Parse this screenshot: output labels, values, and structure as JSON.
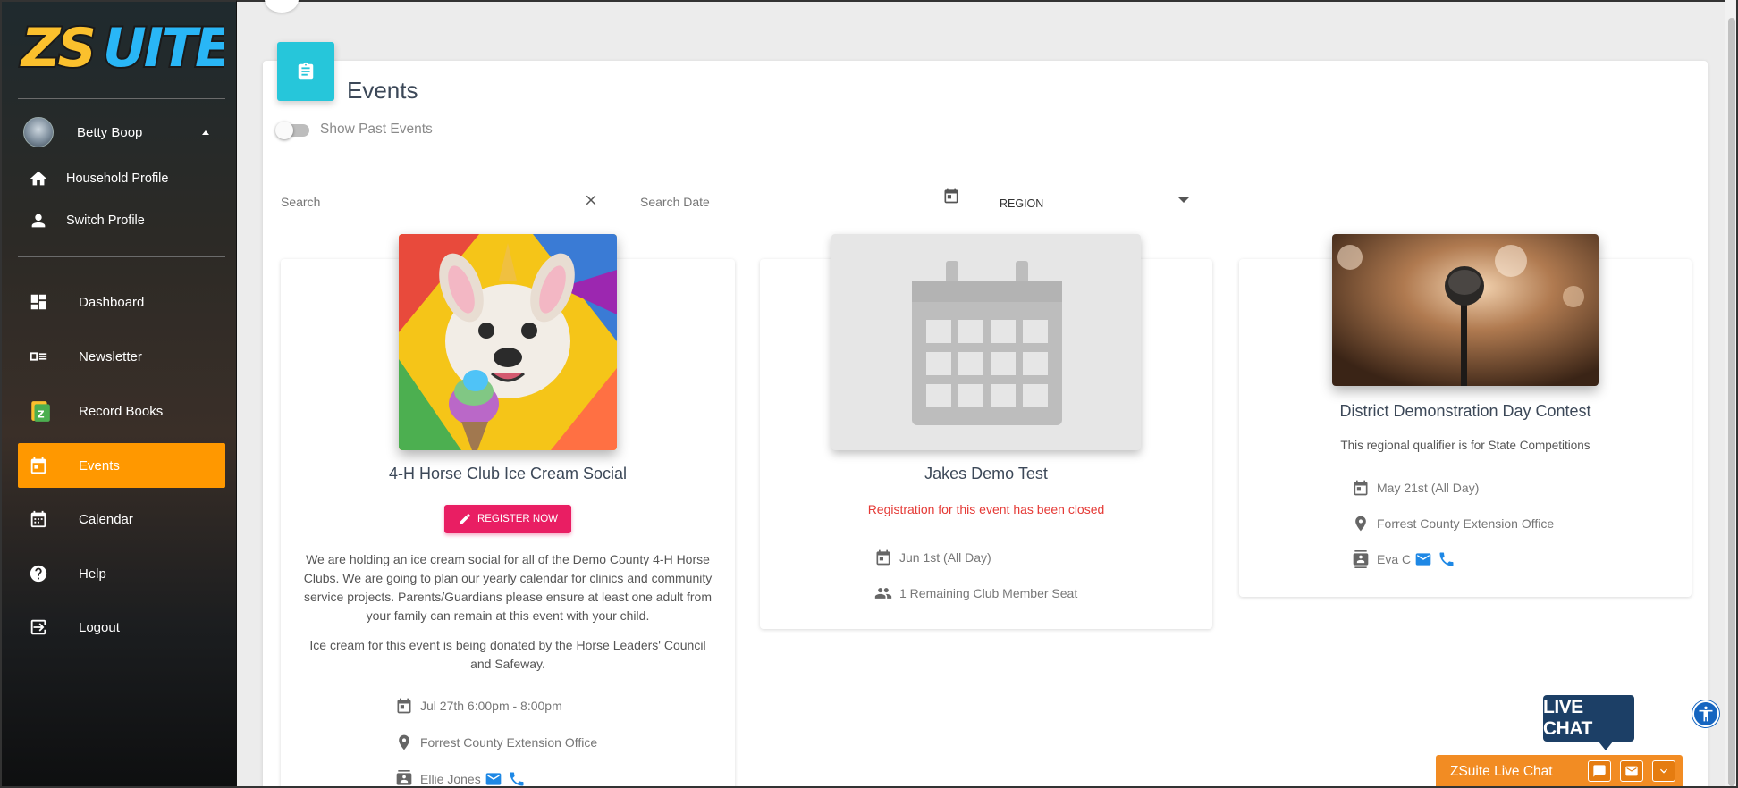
{
  "brand": {
    "logo_text": "ZSUITE"
  },
  "sidebar": {
    "user_name": "Betty Boop",
    "sub_items": [
      {
        "label": "Household Profile",
        "icon": "home-icon"
      },
      {
        "label": "Switch Profile",
        "icon": "person-icon"
      }
    ],
    "items": [
      {
        "label": "Dashboard",
        "icon": "dashboard-icon"
      },
      {
        "label": "Newsletter",
        "icon": "newsletter-icon"
      },
      {
        "label": "Record Books",
        "icon": "record-books-icon"
      },
      {
        "label": "Events",
        "icon": "calendar-icon",
        "active": true
      },
      {
        "label": "Calendar",
        "icon": "calendar-icon"
      },
      {
        "label": "Help",
        "icon": "help-icon"
      },
      {
        "label": "Logout",
        "icon": "logout-icon"
      }
    ]
  },
  "main": {
    "title": "Events",
    "show_past_label": "Show Past Events",
    "search_placeholder": "Search",
    "date_placeholder": "Search Date",
    "region_label": "REGION"
  },
  "events": [
    {
      "title": "4-H Horse Club Ice Cream Social",
      "button": "REGISTER NOW",
      "desc1": "We are holding an ice cream social for all of the Demo County 4-H Horse Clubs. We are going to plan our yearly calendar for clinics and community service projects. Parents/Guardians please ensure at least one adult from your family can remain at this event with your child.",
      "desc2": "Ice cream for this event is being donated by the Horse Leaders' Council and Safeway.",
      "date": "Jul 27th 6:00pm - 8:00pm",
      "location": "Forrest County Extension Office",
      "contact": "Ellie Jones"
    },
    {
      "title": "Jakes Demo Test",
      "status": "Registration for this event has been closed",
      "date": "Jun 1st (All Day)",
      "seats": "1 Remaining Club Member Seat"
    },
    {
      "title": "District Demonstration Day Contest",
      "desc": "This regional qualifier is for State Competitions",
      "date": "May 21st (All Day)",
      "location": "Forrest County Extension Office",
      "contact": "Eva C"
    }
  ],
  "chat": {
    "bubble": "LIVE CHAT",
    "bar_label": "ZSuite Live Chat"
  },
  "colors": {
    "accent_orange": "#ff9800",
    "teal": "#26c6da",
    "register_pink": "#e91e63",
    "closed_red": "#e53935"
  }
}
